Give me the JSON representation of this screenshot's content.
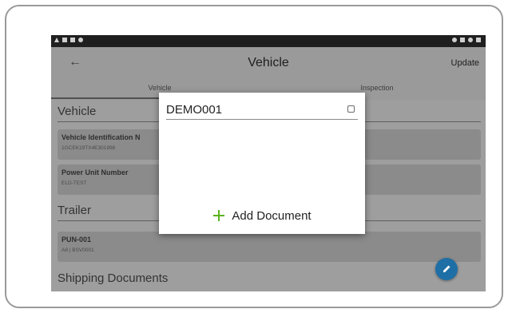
{
  "app": {
    "title": "Vehicle",
    "back_icon": "back-arrow-icon",
    "update_label": "Update"
  },
  "tabs": [
    {
      "label": "Vehicle",
      "active": true
    },
    {
      "label": "Inspection",
      "active": false
    }
  ],
  "sections": {
    "vehicle": {
      "title": "Vehicle",
      "cards": [
        {
          "label": "Vehicle Identification N",
          "value": "1GCEK19TX4E301998"
        },
        {
          "label": "Power Unit Number",
          "value": "ELD-TEST"
        }
      ]
    },
    "trailer": {
      "title": "Trailer",
      "cards": [
        {
          "label": "PUN-001",
          "value": "A8 | BSV0001"
        }
      ]
    },
    "shipping": {
      "title": "Shipping Documents"
    }
  },
  "dialog": {
    "document_name": "DEMO001",
    "checked": false,
    "add_label": "Add Document",
    "add_icon": "plus-icon"
  },
  "fab": {
    "icon": "edit-pencil-icon",
    "color": "#1e6fa6"
  },
  "colors": {
    "overlay": "#9e9e9e",
    "accent_green": "#5cb21e",
    "status_bar": "#1f1f1f"
  }
}
